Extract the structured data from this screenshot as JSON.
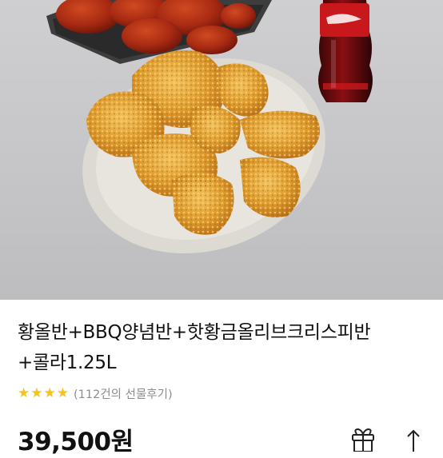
{
  "product": {
    "title_line1": "황올반+BBQ양념반+핫황금올리브크리스피반",
    "title_line2": "+콜라1.25L",
    "rating_stars": 4,
    "review_text": "(112건의 선물후기)",
    "price": "39,500원"
  },
  "icons": {
    "gift": "gift-icon",
    "share": "share-icon",
    "star": "star-icon"
  },
  "colors": {
    "star": "#f6c21b",
    "text": "#111111",
    "muted": "#8d8d8d"
  }
}
